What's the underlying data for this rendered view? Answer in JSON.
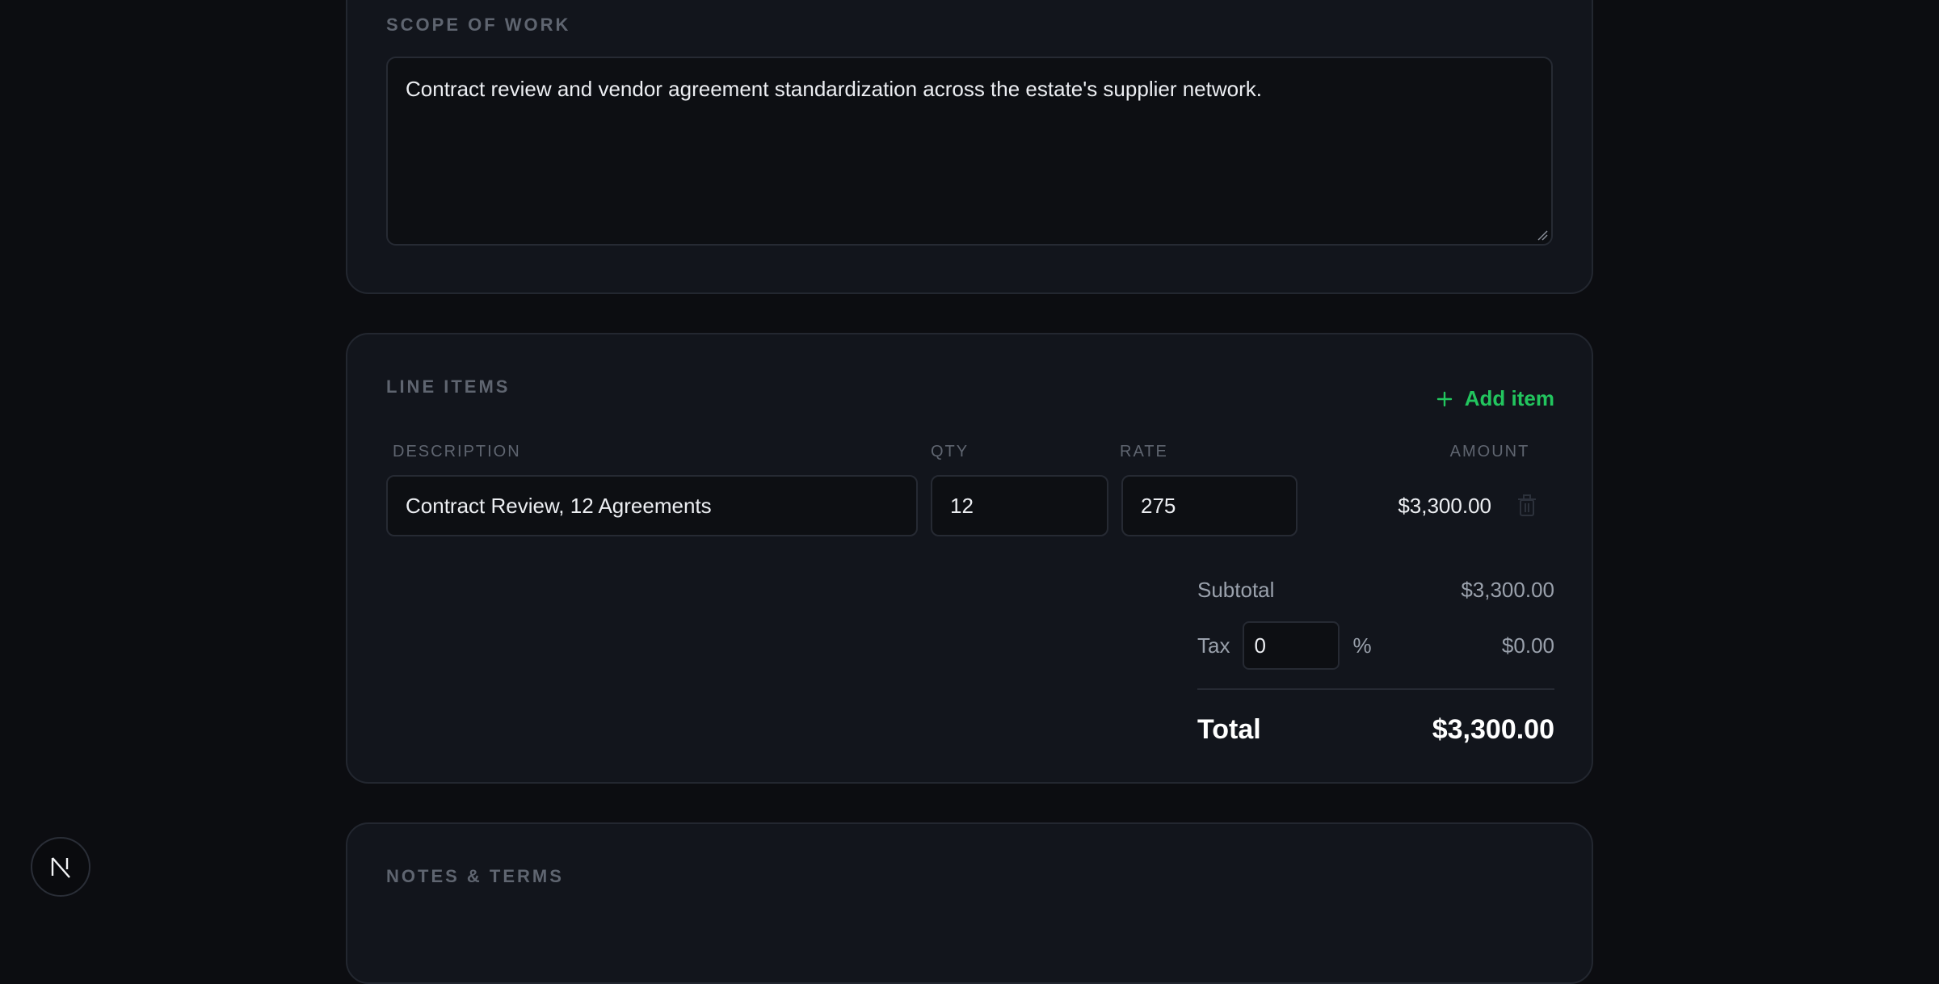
{
  "scope": {
    "title": "SCOPE OF WORK",
    "text": "Contract review and vendor agreement standardization across the estate's supplier network."
  },
  "line_items": {
    "title": "LINE ITEMS",
    "add_label": "Add item",
    "columns": {
      "description": "DESCRIPTION",
      "qty": "QTY",
      "rate": "RATE",
      "amount": "AMOUNT"
    },
    "rows": [
      {
        "description": "Contract Review, 12 Agreements",
        "qty": "12",
        "rate": "275",
        "amount": "$3,300.00"
      }
    ],
    "totals": {
      "subtotal_label": "Subtotal",
      "subtotal_value": "$3,300.00",
      "tax_label": "Tax",
      "tax_rate": "0",
      "tax_unit": "%",
      "tax_value": "$0.00",
      "total_label": "Total",
      "total_value": "$3,300.00"
    }
  },
  "notes": {
    "title": "NOTES & TERMS"
  },
  "badge": {
    "icon": "next-logo-icon"
  },
  "colors": {
    "accent": "#22c55e",
    "background": "#0c0d11",
    "card": "#12151c"
  }
}
